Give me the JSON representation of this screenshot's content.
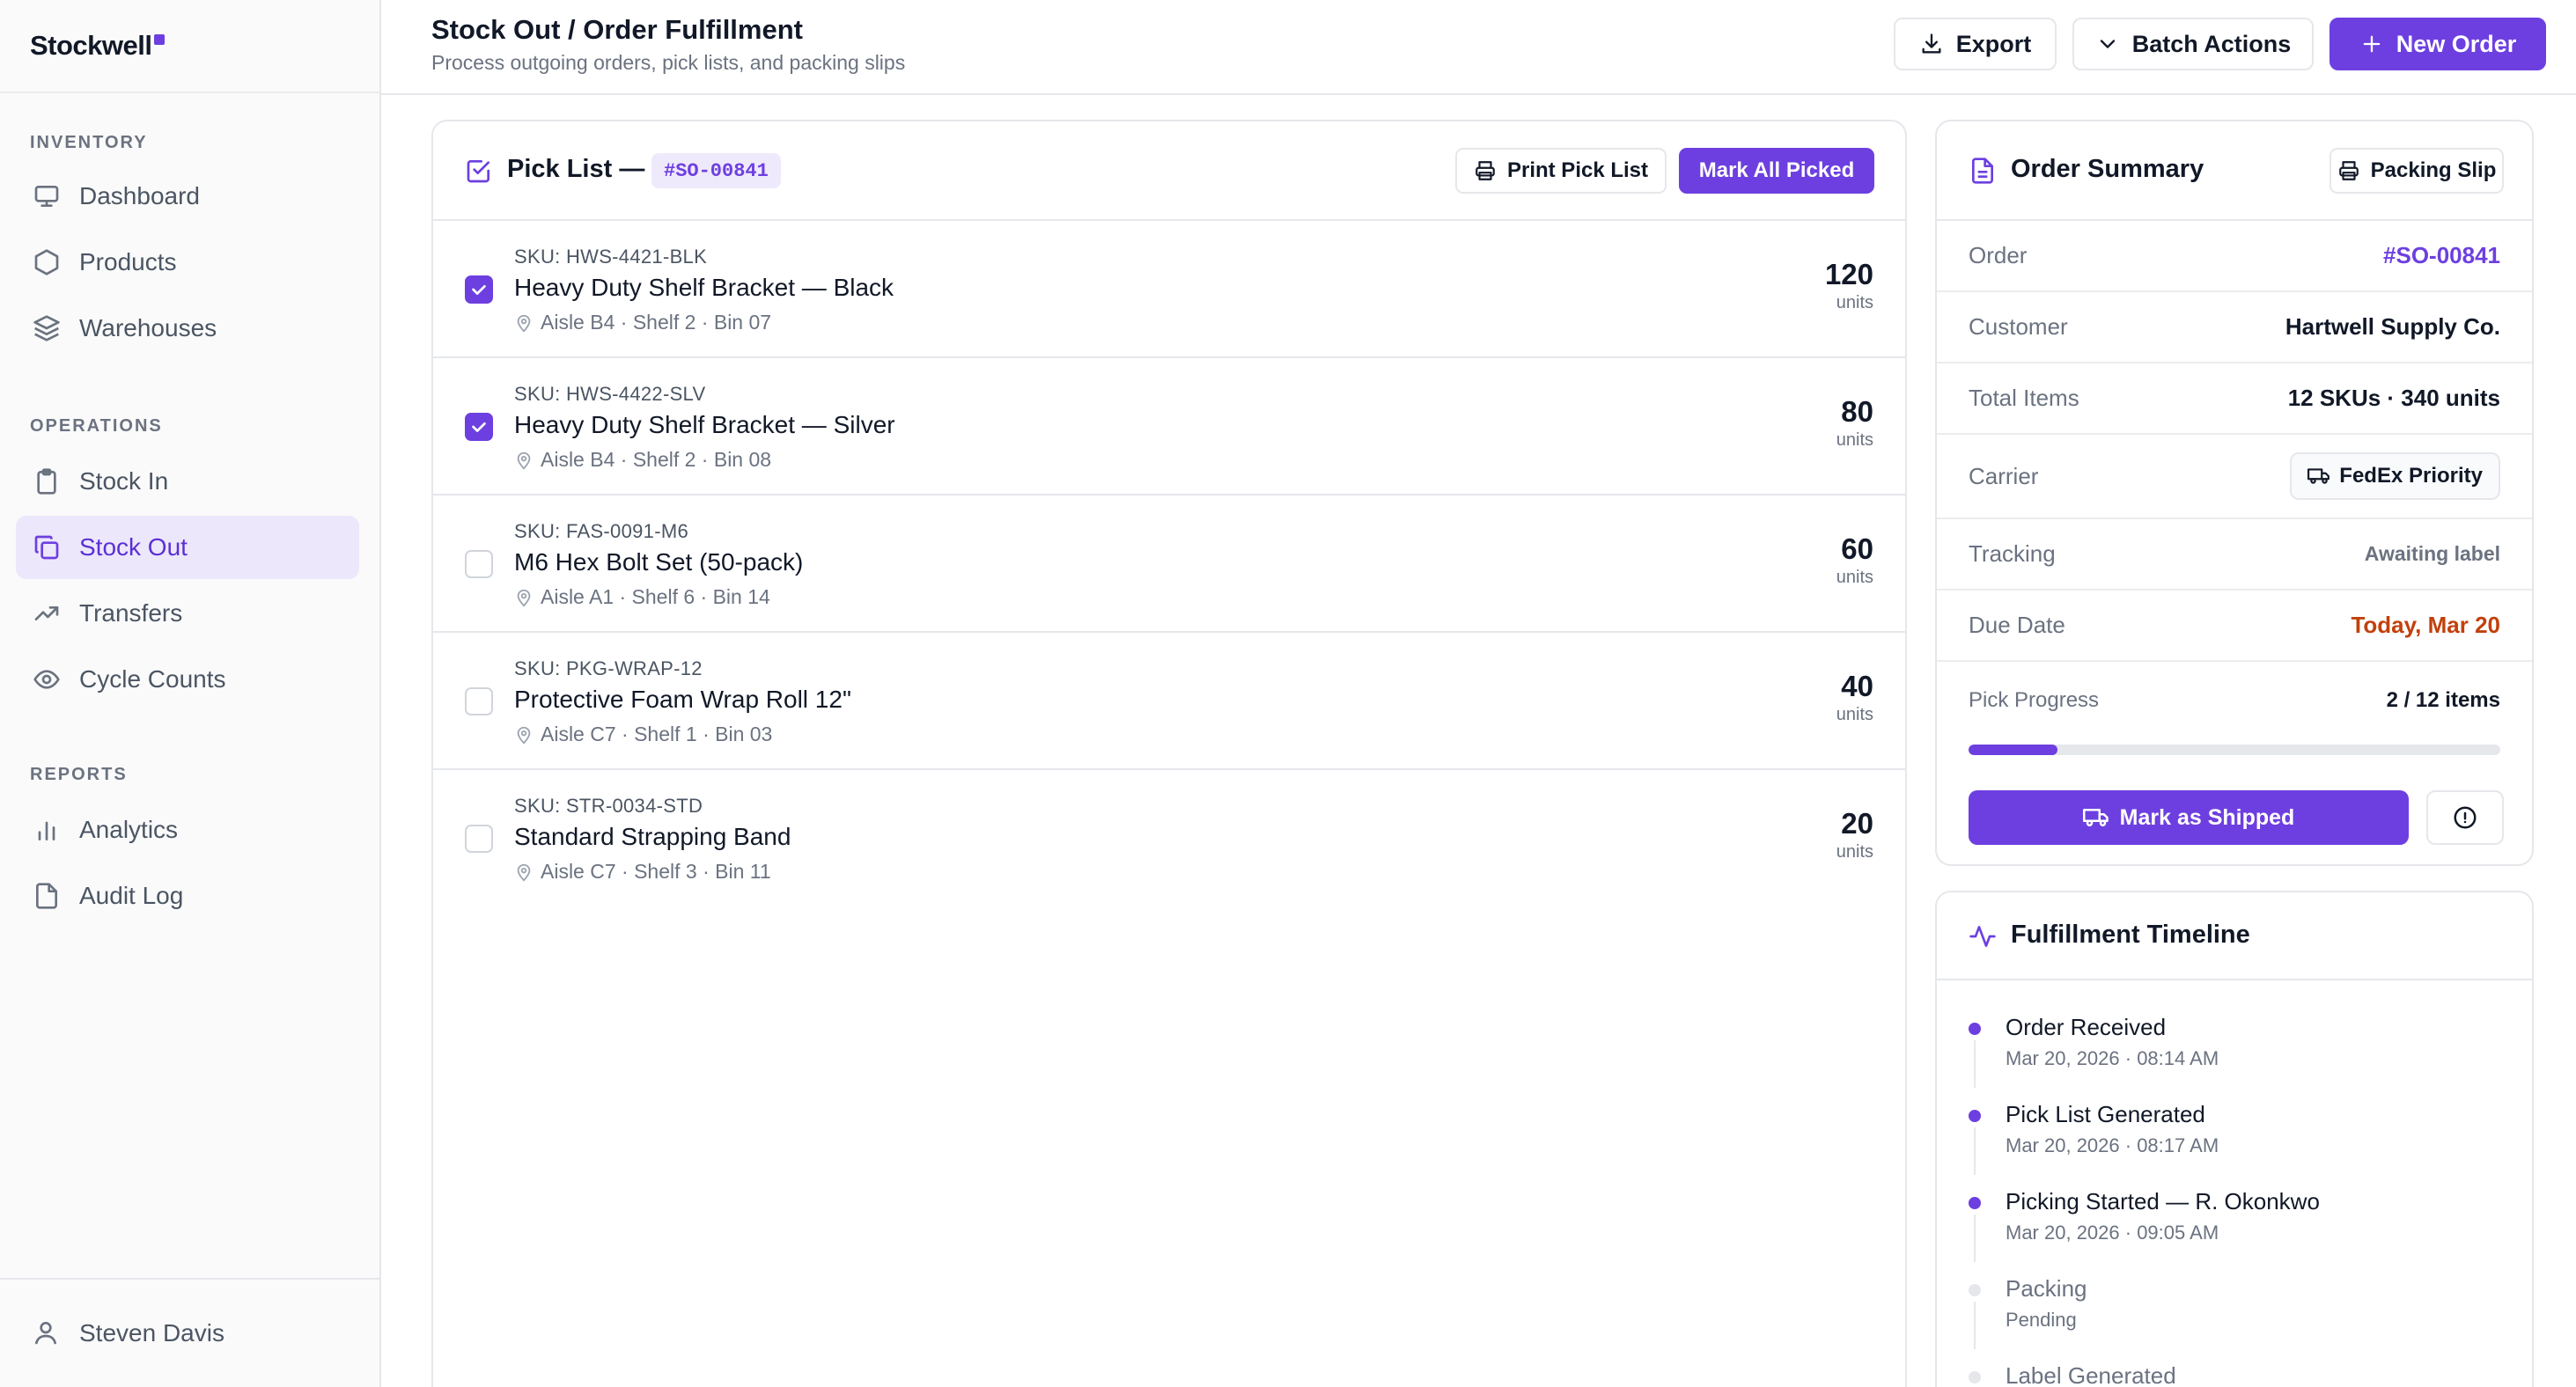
{
  "brand": {
    "name": "Stockwell",
    "accent": "#6d3fe0"
  },
  "sidebar": {
    "sections": [
      {
        "title": "INVENTORY",
        "items": [
          {
            "label": "Dashboard",
            "icon": "monitor-icon"
          },
          {
            "label": "Products",
            "icon": "hexagon-icon"
          },
          {
            "label": "Warehouses",
            "icon": "layers-icon"
          }
        ]
      },
      {
        "title": "OPERATIONS",
        "items": [
          {
            "label": "Stock In",
            "icon": "clipboard-icon"
          },
          {
            "label": "Stock Out",
            "icon": "copy-icon",
            "active": true
          },
          {
            "label": "Transfers",
            "icon": "trending-up-icon"
          },
          {
            "label": "Cycle Counts",
            "icon": "eye-icon"
          }
        ]
      },
      {
        "title": "REPORTS",
        "items": [
          {
            "label": "Analytics",
            "icon": "bar-chart-icon"
          },
          {
            "label": "Audit Log",
            "icon": "file-icon"
          }
        ]
      }
    ],
    "user": {
      "name": "Steven Davis",
      "icon": "user-icon"
    }
  },
  "header": {
    "title": "Stock Out / Order Fulfillment",
    "subtitle": "Process outgoing orders, pick lists, and packing slips",
    "export_label": "Export",
    "batch_label": "Batch Actions",
    "new_order_label": "New Order"
  },
  "pick_list": {
    "title": "Pick List —",
    "order_id": "#SO-00841",
    "print_label": "Print Pick List",
    "mark_all_label": "Mark All Picked",
    "items": [
      {
        "sku": "SKU: HWS-4421-BLK",
        "name": "Heavy Duty Shelf Bracket — Black",
        "location": "Aisle B4 · Shelf 2 · Bin 07",
        "qty": "120",
        "unit": "units",
        "picked": true
      },
      {
        "sku": "SKU: HWS-4422-SLV",
        "name": "Heavy Duty Shelf Bracket — Silver",
        "location": "Aisle B4 · Shelf 2 · Bin 08",
        "qty": "80",
        "unit": "units",
        "picked": true
      },
      {
        "sku": "SKU: FAS-0091-M6",
        "name": "M6 Hex Bolt Set (50-pack)",
        "location": "Aisle A1 · Shelf 6 · Bin 14",
        "qty": "60",
        "unit": "units",
        "picked": false
      },
      {
        "sku": "SKU: PKG-WRAP-12",
        "name": "Protective Foam Wrap Roll 12\"",
        "location": "Aisle C7 · Shelf 1 · Bin 03",
        "qty": "40",
        "unit": "units",
        "picked": false
      },
      {
        "sku": "SKU: STR-0034-STD",
        "name": "Standard Strapping Band",
        "location": "Aisle C7 · Shelf 3 · Bin 11",
        "qty": "20",
        "unit": "units",
        "picked": false
      }
    ]
  },
  "summary": {
    "title": "Order Summary",
    "packing_slip_label": "Packing Slip",
    "order_label": "Order",
    "order_value": "#SO-00841",
    "customer_label": "Customer",
    "customer_value": "Hartwell Supply Co.",
    "total_label": "Total Items",
    "total_value": "12 SKUs · 340 units",
    "carrier_label": "Carrier",
    "carrier_value": "FedEx Priority",
    "tracking_label": "Tracking",
    "tracking_value": "Awaiting label",
    "due_label": "Due Date",
    "due_value": "Today, Mar 20",
    "due_color": "#c2410c",
    "progress_label": "Pick Progress",
    "progress_value": "2 / 12 items",
    "progress_fraction": 0.1667,
    "ship_label": "Mark as Shipped"
  },
  "timeline": {
    "title": "Fulfillment Timeline",
    "events": [
      {
        "label": "Order Received",
        "sub": "Mar 20, 2026 · 08:14 AM",
        "done": true
      },
      {
        "label": "Pick List Generated",
        "sub": "Mar 20, 2026 · 08:17 AM",
        "done": true
      },
      {
        "label": "Picking Started — R. Okonkwo",
        "sub": "Mar 20, 2026 · 09:05 AM",
        "done": true
      },
      {
        "label": "Packing",
        "sub": "Pending",
        "done": false
      },
      {
        "label": "Label Generated",
        "sub": "",
        "done": false
      }
    ]
  }
}
